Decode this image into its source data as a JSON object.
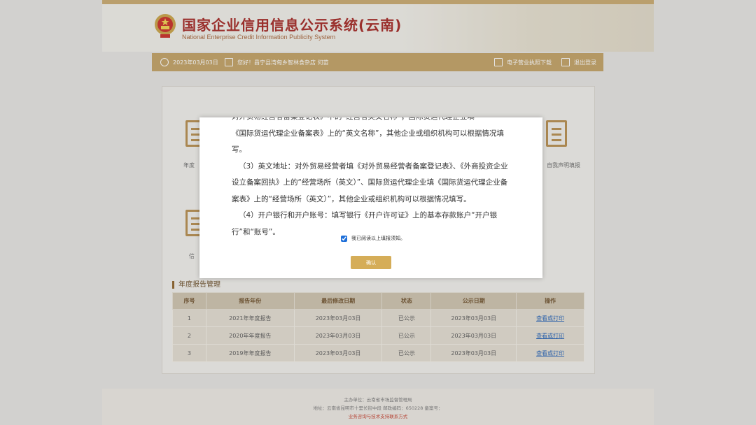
{
  "header": {
    "title": "国家企业信用信息公示系统(云南)",
    "subtitle": "National Enterprise Credit Information Publicity System"
  },
  "navbar": {
    "date": "2023年03月03日",
    "greeting": "您好！昌宁县湾甸乡智林食杂店  何苗",
    "download": "电子营业执照下载",
    "logout": "退出登录"
  },
  "features": {
    "left_1": "年度",
    "right_1": "自我声明填报",
    "left_2": "信"
  },
  "modal": {
    "paragraphs": [
      "对外贸易经营者备案登记表》中的“经营者英文名称”；国际货运代理企业填",
      "《国际货运代理企业备案表》上的“英文名称”，其他企业或组织机构可以根据情况填写。",
      "（3）英文地址：对外贸易经营者填《对外贸易经营者备案登记表》、《外商投资企业设立备案回执》上的“经营场所（英文）”、国际货运代理企业填《国际货运代理企业备案表》上的“经营场所（英文）”，其他企业或组织机构可以根据情况填写。",
      "（4）开户银行和开户账号：填写银行《开户许可证》上的基本存款账户“开户银行”和“账号”。"
    ],
    "agree_label": "我已阅读以上填报须知。",
    "agree_checked": true,
    "confirm_label": "确认"
  },
  "reports": {
    "section_title": "年度报告管理",
    "columns": [
      "序号",
      "报告年份",
      "最后修改日期",
      "状态",
      "公示日期",
      "操作"
    ],
    "rows": [
      {
        "no": "1",
        "year": "2021年年度报告",
        "modified": "2023年03月03日",
        "status": "已公示",
        "published": "2023年03月03日",
        "action": "查看或打印"
      },
      {
        "no": "2",
        "year": "2020年年度报告",
        "modified": "2023年03月03日",
        "status": "已公示",
        "published": "2023年03月03日",
        "action": "查看或打印"
      },
      {
        "no": "3",
        "year": "2019年年度报告",
        "modified": "2023年03月03日",
        "status": "已公示",
        "published": "2023年03月03日",
        "action": "查看或打印"
      }
    ]
  },
  "footer": {
    "sponsor": "主办单位：云南省市场监督管理局",
    "address": "地址：云南省昆明市十里长街中段  邮政编码：650228  备案号：",
    "contact": "业务咨询与技术支持联系方式"
  },
  "colors": {
    "accent_gold": "#c19f60",
    "title_red": "#a21f1c",
    "link_blue": "#1f5fb5"
  }
}
